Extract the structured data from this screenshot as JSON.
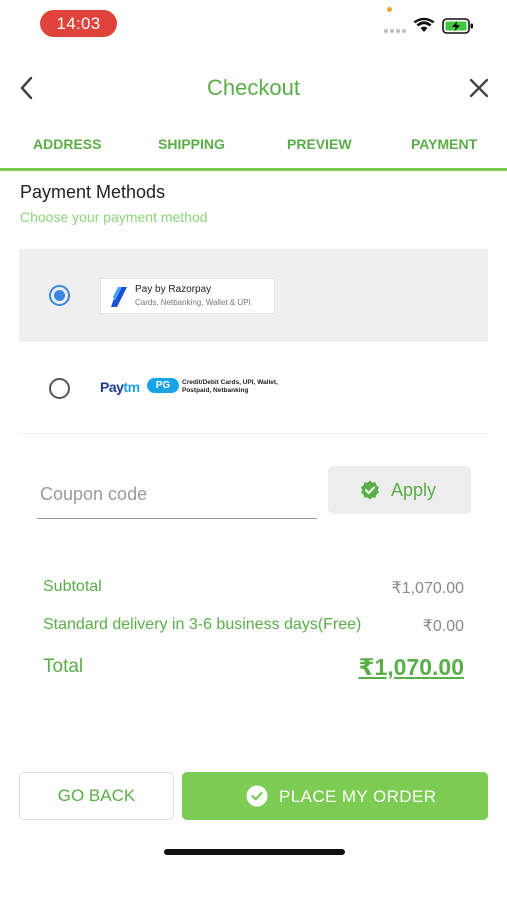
{
  "status_bar": {
    "time": "14:03"
  },
  "header": {
    "title": "Checkout"
  },
  "tabs": [
    {
      "label": "ADDRESS"
    },
    {
      "label": "SHIPPING"
    },
    {
      "label": "PREVIEW"
    },
    {
      "label": "PAYMENT",
      "active": true
    }
  ],
  "payment": {
    "title": "Payment Methods",
    "subtitle": "Choose your payment method",
    "options": [
      {
        "name": "Pay by Razorpay",
        "description": "Cards, Netbanking, Wallet & UPI",
        "selected": true
      },
      {
        "brand": "Paytm",
        "brand_a": "Pay",
        "brand_b": "tm",
        "badge": "PG",
        "description": "Credit/Debit Cards, UPI, Wallet, Postpaid, Netbanking",
        "selected": false
      }
    ]
  },
  "coupon": {
    "placeholder": "Coupon code",
    "value": "",
    "apply_label": "Apply"
  },
  "summary": {
    "subtotal_label": "Subtotal",
    "subtotal_value": "₹1,070.00",
    "delivery_label": "Standard delivery in 3-6 business days(Free)",
    "delivery_value": "₹0.00",
    "total_label": "Total",
    "total_value": "₹1,070.00"
  },
  "actions": {
    "back_label": "GO BACK",
    "order_label": "PLACE MY ORDER"
  },
  "colors": {
    "accent": "#7ccb52",
    "accent_text": "#5aae48",
    "time_pill": "#e0433b",
    "radio": "#3a87e0"
  }
}
